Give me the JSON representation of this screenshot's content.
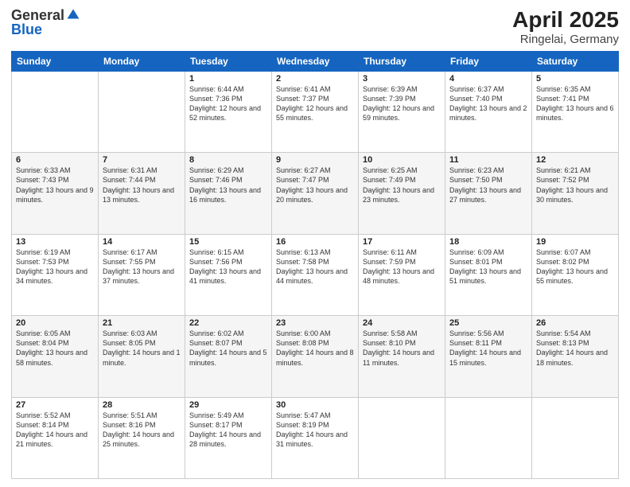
{
  "logo": {
    "general": "General",
    "blue": "Blue"
  },
  "title": "April 2025",
  "location": "Ringelai, Germany",
  "headers": [
    "Sunday",
    "Monday",
    "Tuesday",
    "Wednesday",
    "Thursday",
    "Friday",
    "Saturday"
  ],
  "weeks": [
    [
      {
        "day": "",
        "info": ""
      },
      {
        "day": "",
        "info": ""
      },
      {
        "day": "1",
        "info": "Sunrise: 6:44 AM\nSunset: 7:36 PM\nDaylight: 12 hours and 52 minutes."
      },
      {
        "day": "2",
        "info": "Sunrise: 6:41 AM\nSunset: 7:37 PM\nDaylight: 12 hours and 55 minutes."
      },
      {
        "day": "3",
        "info": "Sunrise: 6:39 AM\nSunset: 7:39 PM\nDaylight: 12 hours and 59 minutes."
      },
      {
        "day": "4",
        "info": "Sunrise: 6:37 AM\nSunset: 7:40 PM\nDaylight: 13 hours and 2 minutes."
      },
      {
        "day": "5",
        "info": "Sunrise: 6:35 AM\nSunset: 7:41 PM\nDaylight: 13 hours and 6 minutes."
      }
    ],
    [
      {
        "day": "6",
        "info": "Sunrise: 6:33 AM\nSunset: 7:43 PM\nDaylight: 13 hours and 9 minutes."
      },
      {
        "day": "7",
        "info": "Sunrise: 6:31 AM\nSunset: 7:44 PM\nDaylight: 13 hours and 13 minutes."
      },
      {
        "day": "8",
        "info": "Sunrise: 6:29 AM\nSunset: 7:46 PM\nDaylight: 13 hours and 16 minutes."
      },
      {
        "day": "9",
        "info": "Sunrise: 6:27 AM\nSunset: 7:47 PM\nDaylight: 13 hours and 20 minutes."
      },
      {
        "day": "10",
        "info": "Sunrise: 6:25 AM\nSunset: 7:49 PM\nDaylight: 13 hours and 23 minutes."
      },
      {
        "day": "11",
        "info": "Sunrise: 6:23 AM\nSunset: 7:50 PM\nDaylight: 13 hours and 27 minutes."
      },
      {
        "day": "12",
        "info": "Sunrise: 6:21 AM\nSunset: 7:52 PM\nDaylight: 13 hours and 30 minutes."
      }
    ],
    [
      {
        "day": "13",
        "info": "Sunrise: 6:19 AM\nSunset: 7:53 PM\nDaylight: 13 hours and 34 minutes."
      },
      {
        "day": "14",
        "info": "Sunrise: 6:17 AM\nSunset: 7:55 PM\nDaylight: 13 hours and 37 minutes."
      },
      {
        "day": "15",
        "info": "Sunrise: 6:15 AM\nSunset: 7:56 PM\nDaylight: 13 hours and 41 minutes."
      },
      {
        "day": "16",
        "info": "Sunrise: 6:13 AM\nSunset: 7:58 PM\nDaylight: 13 hours and 44 minutes."
      },
      {
        "day": "17",
        "info": "Sunrise: 6:11 AM\nSunset: 7:59 PM\nDaylight: 13 hours and 48 minutes."
      },
      {
        "day": "18",
        "info": "Sunrise: 6:09 AM\nSunset: 8:01 PM\nDaylight: 13 hours and 51 minutes."
      },
      {
        "day": "19",
        "info": "Sunrise: 6:07 AM\nSunset: 8:02 PM\nDaylight: 13 hours and 55 minutes."
      }
    ],
    [
      {
        "day": "20",
        "info": "Sunrise: 6:05 AM\nSunset: 8:04 PM\nDaylight: 13 hours and 58 minutes."
      },
      {
        "day": "21",
        "info": "Sunrise: 6:03 AM\nSunset: 8:05 PM\nDaylight: 14 hours and 1 minute."
      },
      {
        "day": "22",
        "info": "Sunrise: 6:02 AM\nSunset: 8:07 PM\nDaylight: 14 hours and 5 minutes."
      },
      {
        "day": "23",
        "info": "Sunrise: 6:00 AM\nSunset: 8:08 PM\nDaylight: 14 hours and 8 minutes."
      },
      {
        "day": "24",
        "info": "Sunrise: 5:58 AM\nSunset: 8:10 PM\nDaylight: 14 hours and 11 minutes."
      },
      {
        "day": "25",
        "info": "Sunrise: 5:56 AM\nSunset: 8:11 PM\nDaylight: 14 hours and 15 minutes."
      },
      {
        "day": "26",
        "info": "Sunrise: 5:54 AM\nSunset: 8:13 PM\nDaylight: 14 hours and 18 minutes."
      }
    ],
    [
      {
        "day": "27",
        "info": "Sunrise: 5:52 AM\nSunset: 8:14 PM\nDaylight: 14 hours and 21 minutes."
      },
      {
        "day": "28",
        "info": "Sunrise: 5:51 AM\nSunset: 8:16 PM\nDaylight: 14 hours and 25 minutes."
      },
      {
        "day": "29",
        "info": "Sunrise: 5:49 AM\nSunset: 8:17 PM\nDaylight: 14 hours and 28 minutes."
      },
      {
        "day": "30",
        "info": "Sunrise: 5:47 AM\nSunset: 8:19 PM\nDaylight: 14 hours and 31 minutes."
      },
      {
        "day": "",
        "info": ""
      },
      {
        "day": "",
        "info": ""
      },
      {
        "day": "",
        "info": ""
      }
    ]
  ]
}
